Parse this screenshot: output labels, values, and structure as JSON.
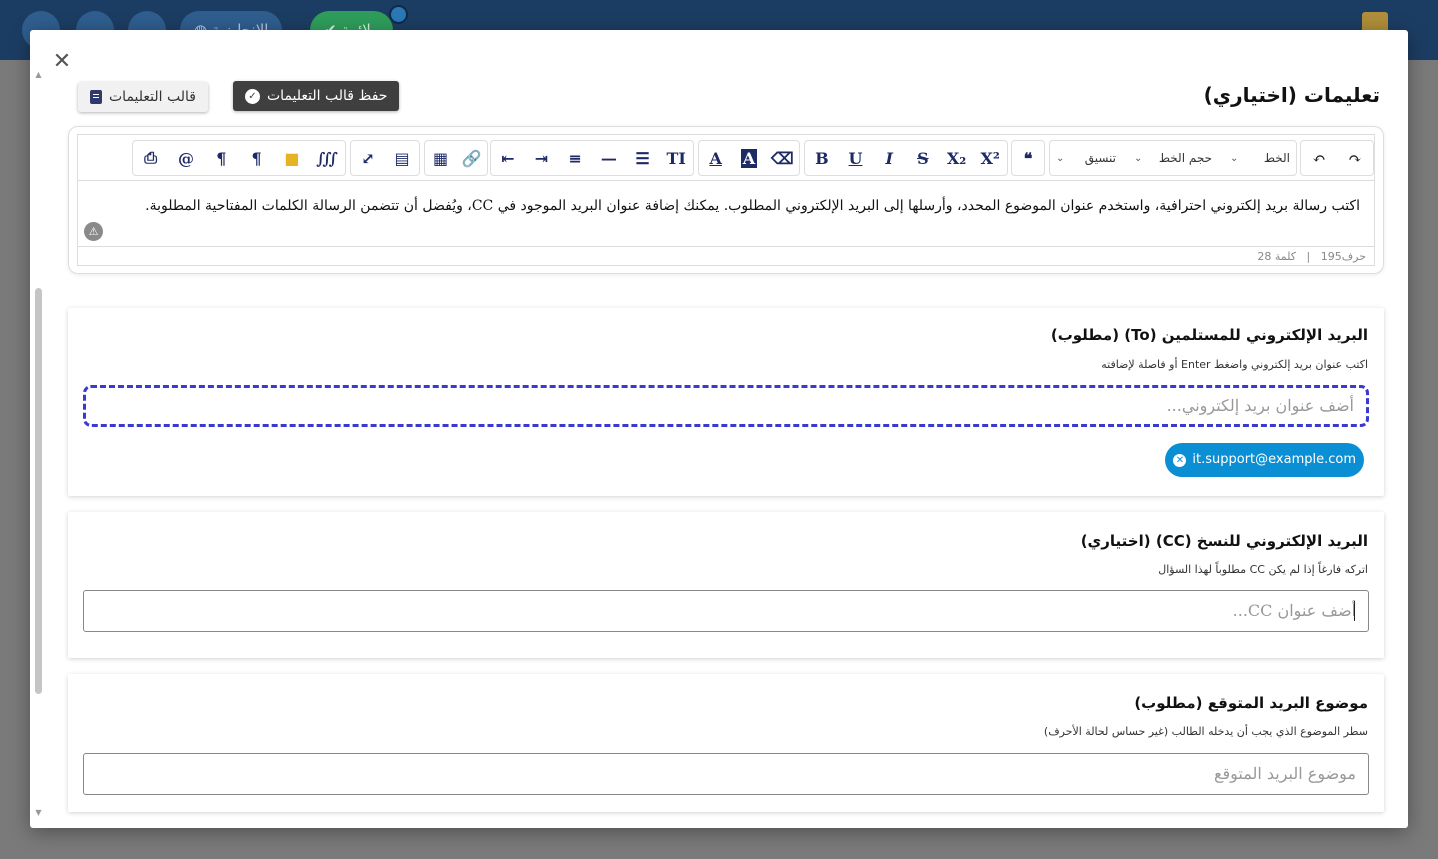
{
  "background": {
    "topbar": {
      "language_label": "الإنجليزية",
      "status_label": "ملائمة"
    }
  },
  "modal": {
    "title": "تعليمات (اختياري)",
    "save_template_label": "حفظ قالب التعليمات",
    "template_label": "قالب التعليمات",
    "editor": {
      "format_select": "تنسيق",
      "font_size_select": "حجم الخط",
      "font_select": "الخط",
      "content": "اكتب رسالة بريد إلكتروني احترافية، واستخدم عنوان الموضوع المحدد، وأرسلها إلى البريد الإلكتروني المطلوب. يمكنك إضافة عنوان البريد الموجود في CC، ويُفضل أن تتضمن الرسالة الكلمات المفتاحية المطلوبة.",
      "char_count": "حرف195",
      "word_count": "كلمة 28",
      "separator": "|"
    },
    "to_field": {
      "label": "البريد الإلكتروني للمستلمين (To) (مطلوب)",
      "hint": "اكتب عنوان بريد إلكتروني واضغط Enter أو فاصلة لإضافته",
      "placeholder": "أضف عنوان بريد إلكتروني...",
      "chips": [
        "it.support@example.com"
      ]
    },
    "cc_field": {
      "label": "البريد الإلكتروني للنسخ (CC) (اختياري)",
      "hint": "اتركه فارغاً إذا لم يكن CC مطلوباً لهذا السؤال",
      "placeholder": "أضف عنوان CC..."
    },
    "subject_field": {
      "label": "موضوع البريد المتوقع (مطلوب)",
      "hint": "سطر الموضوع الذي يجب أن يدخله الطالب (غير حساس لحالة الأحرف)",
      "placeholder": "موضوع البريد المتوقع"
    }
  },
  "colors": {
    "topbar": "#1c3d63",
    "save_button": "#3f3f3f",
    "chip": "#0a8fd4",
    "focus_border": "#3a3ad0"
  }
}
